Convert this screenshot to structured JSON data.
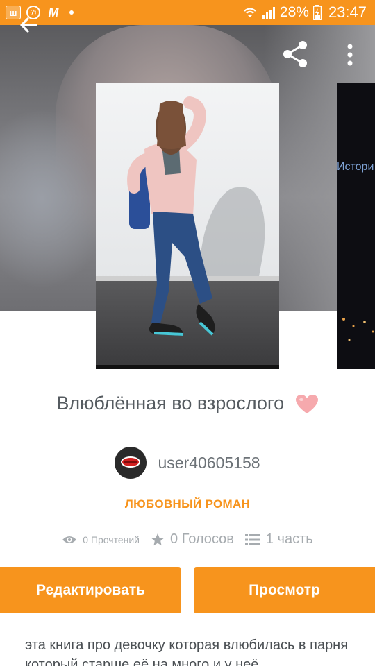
{
  "status_bar": {
    "battery_percent": "28%",
    "time": "23:47"
  },
  "book": {
    "title": "Влюблённая во взрослого",
    "author": "user40605158",
    "genre": "ЛЮБОВНЫЙ РОМАН",
    "reads": "0 Прочтений",
    "votes": "0 Голосов",
    "parts": "1 часть",
    "description": "эта книга про девочку которая влюбилась в парня который старше её на много и у неё"
  },
  "next_cover": {
    "text": "Истори"
  },
  "actions": {
    "edit_label": "Редактировать",
    "view_label": "Просмотр"
  },
  "colors": {
    "accent": "#f7941d",
    "title_text": "#555b60",
    "muted_text": "#a6abaf"
  },
  "icons": {
    "back": "arrow-left-icon",
    "share": "share-icon",
    "more": "more-vert-icon",
    "heart": "heart-emoji-icon",
    "views": "eye-icon",
    "votes": "star-icon",
    "parts": "list-icon"
  }
}
